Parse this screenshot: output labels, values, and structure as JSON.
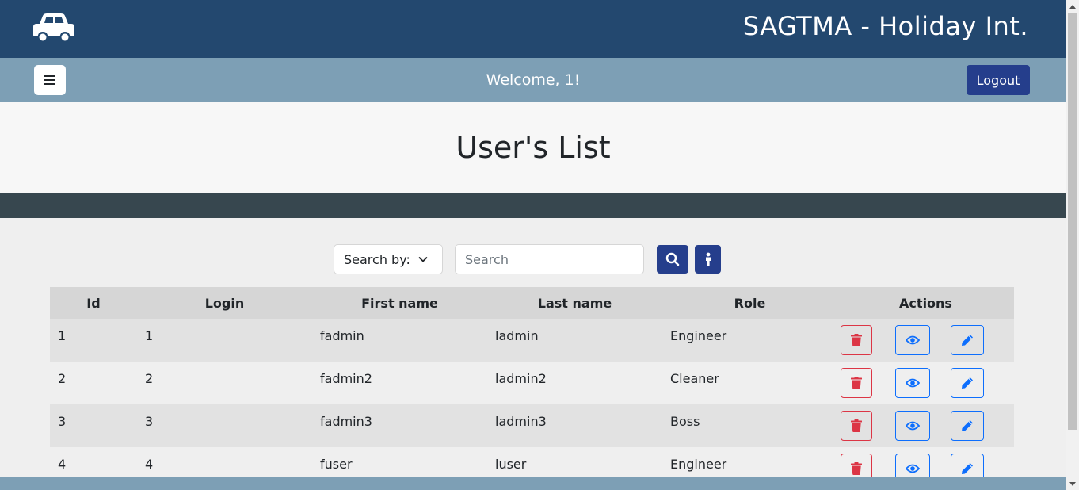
{
  "header": {
    "title": "SAGTMA - Holiday Int.",
    "logo_icon": "car-icon"
  },
  "subbar": {
    "menu_icon": "hamburger-icon",
    "welcome": "Welcome, 1!",
    "logout_label": "Logout"
  },
  "page": {
    "title": "User's List"
  },
  "search": {
    "search_by_label": "Search by:",
    "placeholder": "Search",
    "value": ""
  },
  "table": {
    "columns": [
      "Id",
      "Login",
      "First name",
      "Last name",
      "Role",
      "Actions"
    ],
    "rows": [
      {
        "id": "1",
        "login": "1",
        "first_name": "fadmin",
        "last_name": "ladmin",
        "role": "Engineer"
      },
      {
        "id": "2",
        "login": "2",
        "first_name": "fadmin2",
        "last_name": "ladmin2",
        "role": "Cleaner"
      },
      {
        "id": "3",
        "login": "3",
        "first_name": "fadmin3",
        "last_name": "ladmin3",
        "role": "Boss"
      },
      {
        "id": "4",
        "login": "4",
        "first_name": "fuser",
        "last_name": "luser",
        "role": "Engineer"
      }
    ]
  },
  "colors": {
    "header_bg": "#23486f",
    "subbar_bg": "#7d9fb5",
    "primary_button": "#253e8c",
    "delete": "#dc3545",
    "action_blue": "#0d6efd",
    "band": "#37474f"
  }
}
